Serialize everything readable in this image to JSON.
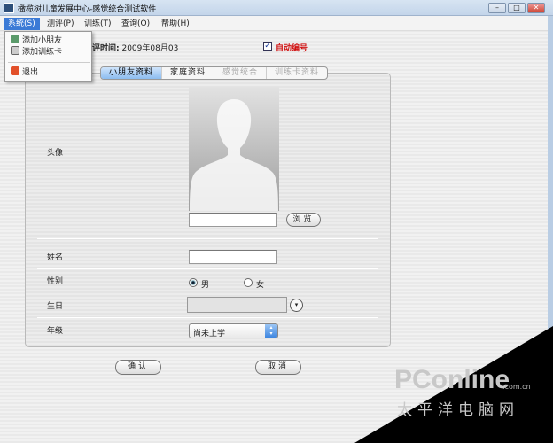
{
  "window": {
    "title": "橄榄树儿童发展中心-感觉统合测试软件",
    "controls": [
      "–",
      "□",
      "✕"
    ]
  },
  "menubar": [
    "系统(S)",
    "测评(P)",
    "训练(T)",
    "查询(O)",
    "帮助(H)"
  ],
  "system_menu": {
    "items": [
      "添加小朋友",
      "添加训练卡",
      "退出"
    ]
  },
  "header": {
    "date_label": "测评时间:",
    "date_value": "2009年08月03",
    "auto_number_label": "自动编号",
    "auto_number_checked": true
  },
  "tabs": [
    "小朋友资料",
    "家庭资料",
    "感觉统合",
    "训练卡资料"
  ],
  "form": {
    "avatar_label": "头像",
    "browse_button": "浏览",
    "name_label": "姓名",
    "gender_label": "性别",
    "gender_options": [
      "男",
      "女"
    ],
    "gender_selected": "男",
    "birthday_label": "生日",
    "grade_label": "年级",
    "grade_value": "尚未上学"
  },
  "actions": {
    "confirm": "确认",
    "cancel": "取消"
  },
  "watermark": {
    "brand": "PConline",
    "domain": ".com.cn",
    "cn": "太平洋电脑网"
  }
}
